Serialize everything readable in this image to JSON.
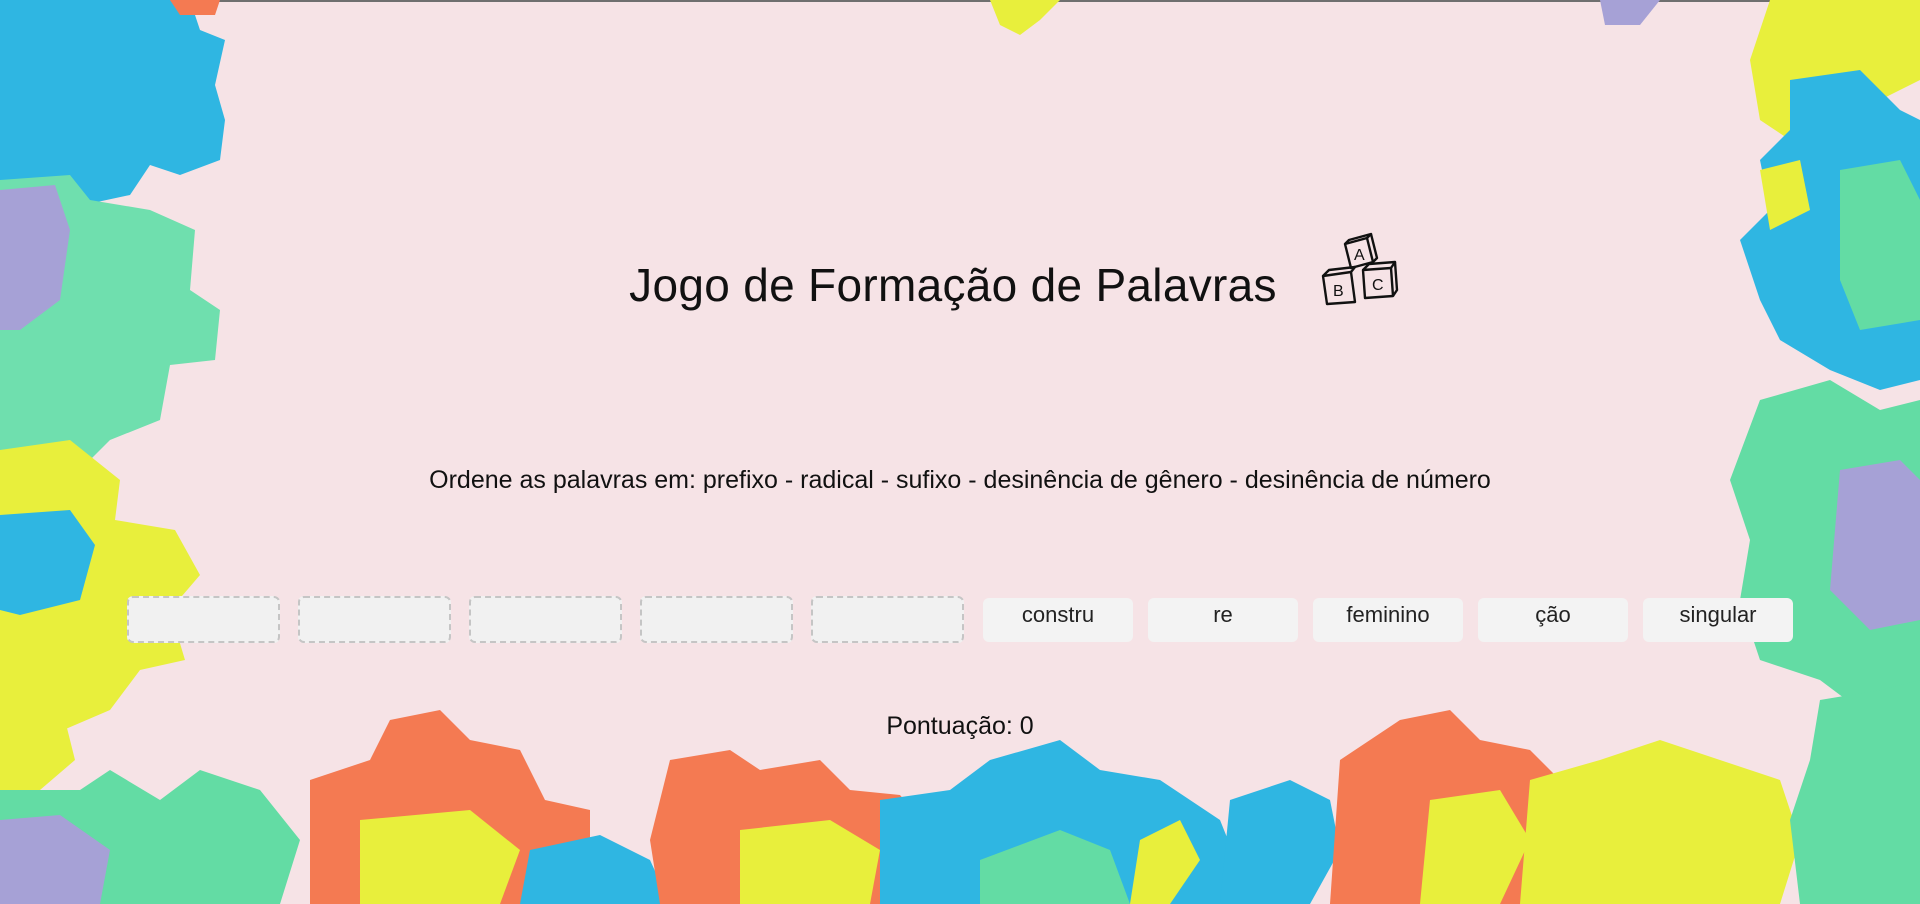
{
  "game": {
    "title": "Jogo de Formação de Palavras",
    "title_icon": "abc-blocks-icon",
    "instruction": "Ordene as palavras em: prefixo - radical - sufixo - desinência de gênero - desinência de número",
    "drop_slots": 5,
    "word_tiles": [
      "constru",
      "re",
      "feminino",
      "ção",
      "singular"
    ],
    "score_text": "Pontuação: 0"
  },
  "colors": {
    "background": "#f6e3e6",
    "puzzle_blue": "#2fb6e2",
    "puzzle_mint": "#63dca4",
    "puzzle_yellow": "#e8ef3c",
    "puzzle_orange": "#f47a52",
    "puzzle_purple": "#a6a1d6"
  }
}
